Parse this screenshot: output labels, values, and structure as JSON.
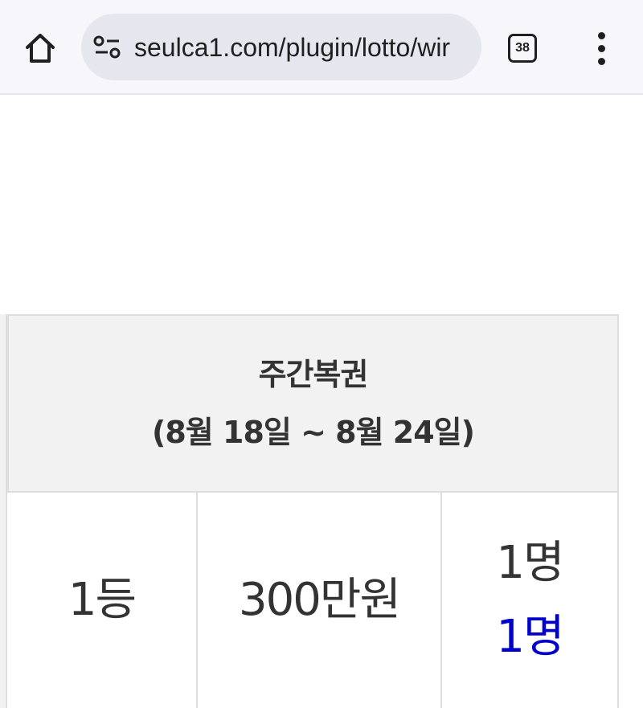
{
  "browser": {
    "url": "seulca1.com/plugin/lotto/wir",
    "tab_count": "38",
    "icons": {
      "home": "home-icon",
      "site_info": "site-info-icon",
      "tabs": "tab-switcher-icon",
      "menu": "more-vert-icon"
    }
  },
  "table": {
    "header": {
      "title": "주간복권",
      "period": "(8월 18일 ~ 8월 24일)"
    },
    "row": {
      "rank": "1등",
      "prize": "300만원",
      "winners": "1명",
      "winners_highlight": "1명"
    }
  },
  "colors": {
    "highlight": "#0000cc",
    "header_bg": "#f2f2f2",
    "border": "#dedede"
  }
}
